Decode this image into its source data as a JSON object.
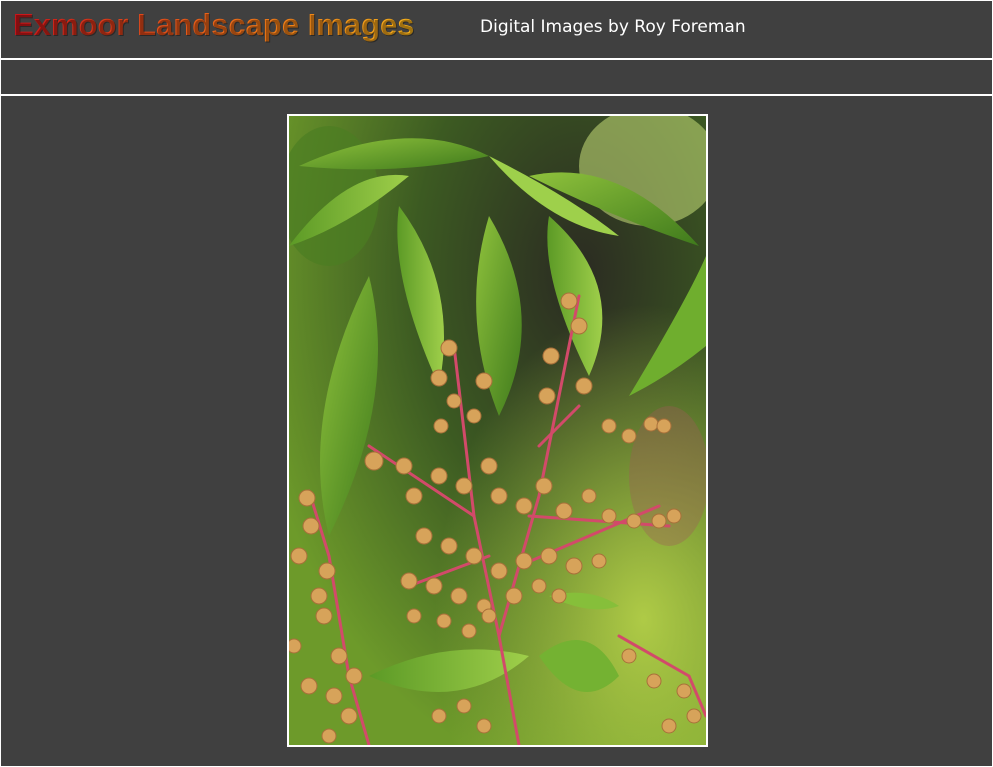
{
  "header": {
    "site_title": "Exmoor Landscape Images",
    "byline": "Digital Images by Roy Foreman"
  },
  "colors": {
    "background": "#404040",
    "rule": "#ffffff",
    "title_gradient_start": "#c8141a",
    "title_gradient_end": "#f5b01a"
  },
  "photo": {
    "subject": "pink flowering shrub buds with green leaves"
  }
}
